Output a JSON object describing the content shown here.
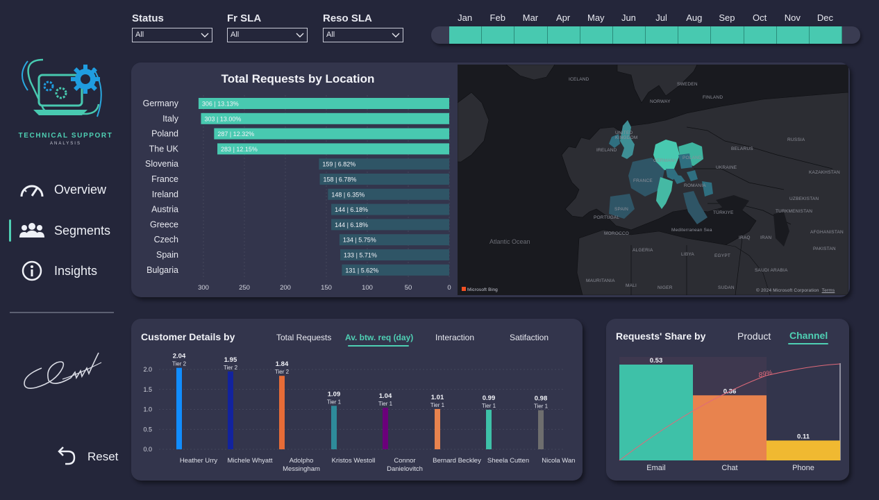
{
  "brand": {
    "title": "TECHNICAL SUPPORT",
    "subtitle": "ANALYSIS"
  },
  "nav": [
    {
      "label": "Overview",
      "icon": "gauge-icon"
    },
    {
      "label": "Segments",
      "icon": "users-icon",
      "active": true
    },
    {
      "label": "Insights",
      "icon": "info-icon"
    }
  ],
  "reset": {
    "label": "Reset"
  },
  "filters": [
    {
      "label": "Status",
      "value": "All"
    },
    {
      "label": "Fr SLA",
      "value": "All"
    },
    {
      "label": "Reso SLA",
      "value": "All"
    }
  ],
  "months": [
    "Jan",
    "Feb",
    "Mar",
    "Apr",
    "May",
    "Jun",
    "Jul",
    "Aug",
    "Sep",
    "Oct",
    "Nov",
    "Dec"
  ],
  "location_card": {
    "title": "Total Requests by Location",
    "map_credit": "Microsoft Bing",
    "map_copyright": "© 2024 Microsoft Corporation",
    "map_terms": "Terms",
    "map_ocean": "Atlantic Ocean",
    "map_sea": "Mediterranean Sea"
  },
  "customer_card": {
    "title": "Customer Details by",
    "tabs": [
      "Total Requests",
      "Av. btw. req (day)",
      "Interaction",
      "Satifaction"
    ],
    "active_tab": 1
  },
  "share_card": {
    "title": "Requests' Share by",
    "tabs": [
      "Product",
      "Channel"
    ],
    "active_tab": 1
  },
  "colors": {
    "accent": "#48c9b0",
    "card": "#33354c",
    "background": "#24263a"
  },
  "chart_data": [
    {
      "type": "bar",
      "orientation": "horizontal",
      "title": "Total Requests by Location",
      "categories": [
        "Germany",
        "Italy",
        "Poland",
        "The UK",
        "Slovenia",
        "France",
        "Ireland",
        "Austria",
        "Greece",
        "Czech",
        "Spain",
        "Bulgaria"
      ],
      "values": [
        306,
        303,
        287,
        283,
        159,
        158,
        148,
        144,
        144,
        134,
        133,
        131
      ],
      "labels": [
        "306 | 13.13%",
        "303 | 13.00%",
        "287 | 12.32%",
        "283 | 12.15%",
        "159 | 6.82%",
        "158 | 6.78%",
        "148 | 6.35%",
        "144 | 6.18%",
        "144 | 6.18%",
        "134 | 5.75%",
        "133 | 5.71%",
        "131 | 5.62%"
      ],
      "xlim": [
        300,
        0
      ],
      "xticks": [
        300,
        250,
        200,
        150,
        100,
        50,
        0
      ],
      "x_reversed": true,
      "colors": {
        "top": "#48c9b0",
        "rest": "#2f5566"
      }
    },
    {
      "type": "bar",
      "title": "Customer Details by",
      "categories": [
        "Heather Urry",
        "Michele Whyatt",
        "Adolpho Messingham",
        "Kristos Westoll",
        "Connor Danielovitch",
        "Bernard Beckley",
        "Sheela Cutten",
        "Nicola Wane"
      ],
      "values": [
        2.04,
        1.95,
        1.84,
        1.09,
        1.04,
        1.01,
        0.99,
        0.98
      ],
      "value_labels": [
        "2.04",
        "1.95",
        "1.84",
        "1.09",
        "1.04",
        "1.01",
        "0.99",
        "0.98"
      ],
      "tiers": [
        "Tier 2",
        "Tier 2",
        "Tier 2",
        "Tier 1",
        "Tier 1",
        "Tier 1",
        "Tier 1",
        "Tier 1"
      ],
      "bar_colors": [
        "#118dff",
        "#12239e",
        "#e66c37",
        "#2e8b9a",
        "#6b007b",
        "#e8834e",
        "#3ec1a8",
        "#6e6e6e"
      ],
      "ylim": [
        0,
        2.0
      ],
      "yticks": [
        "2.0",
        "1.5",
        "1.0",
        "0.5",
        "0.0"
      ],
      "grid": true
    },
    {
      "type": "bar",
      "title": "Requests' Share by",
      "categories": [
        "Email",
        "Chat",
        "Phone"
      ],
      "values": [
        0.53,
        0.36,
        0.11
      ],
      "value_labels": [
        "0.53",
        "0.36",
        "0.11"
      ],
      "bar_colors": [
        "#3ec1a8",
        "#e8834e",
        "#f0b931"
      ],
      "cumulative_line": true,
      "annotation": "89%"
    }
  ]
}
